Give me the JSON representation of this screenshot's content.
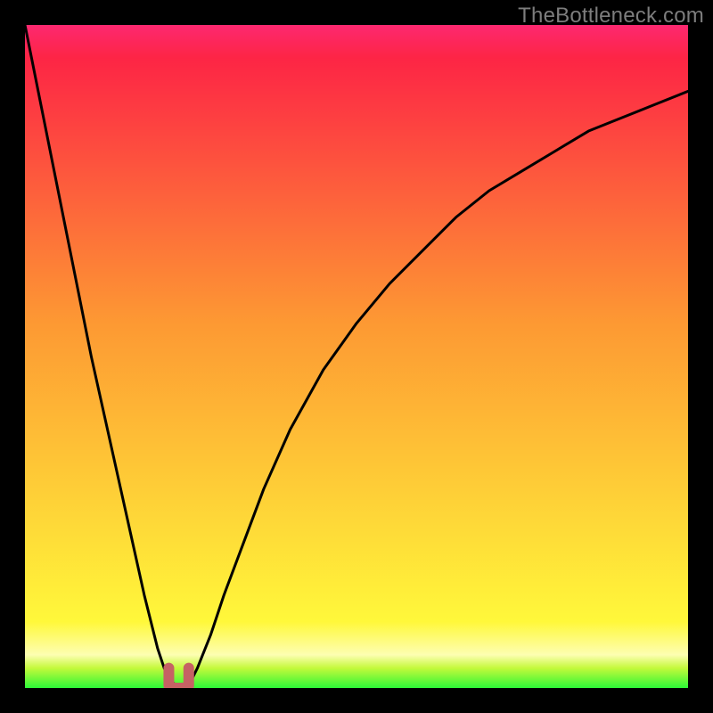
{
  "watermark": "TheBottleneck.com",
  "colors": {
    "black": "#000000",
    "curve": "#000000",
    "green": "#2cf837",
    "yellow": "#fff83a",
    "orange": "#fd9933",
    "red": "#fd2545",
    "pink": "#fd2870",
    "marker": "#c56264"
  },
  "chart_data": {
    "type": "line",
    "title": "",
    "xlabel": "",
    "ylabel": "",
    "xlim": [
      0,
      100
    ],
    "ylim": [
      0,
      100
    ],
    "grid": false,
    "legend": false,
    "gradient_stops": [
      {
        "offset": 0,
        "color": "#2cf837"
      },
      {
        "offset": 3,
        "color": "#c3f93b"
      },
      {
        "offset": 5,
        "color": "#fdfeb2"
      },
      {
        "offset": 10,
        "color": "#fff83a"
      },
      {
        "offset": 55,
        "color": "#fd9933"
      },
      {
        "offset": 95,
        "color": "#fd2545"
      },
      {
        "offset": 100,
        "color": "#fd2870"
      }
    ],
    "curve": {
      "x": [
        0,
        2,
        4,
        6,
        8,
        10,
        12,
        14,
        16,
        18,
        19,
        20,
        21,
        22,
        23,
        24,
        25,
        26,
        28,
        30,
        33,
        36,
        40,
        45,
        50,
        55,
        60,
        65,
        70,
        75,
        80,
        85,
        90,
        95,
        100
      ],
      "y": [
        100,
        90,
        80,
        70,
        60,
        50,
        41,
        32,
        23,
        14,
        10,
        6,
        3,
        1,
        0.3,
        0.3,
        1,
        3,
        8,
        14,
        22,
        30,
        39,
        48,
        55,
        61,
        66,
        71,
        75,
        78,
        81,
        84,
        86,
        88,
        90
      ]
    },
    "marker": {
      "x": 23.2,
      "y": 1.5,
      "width": 3.0,
      "height": 3.0,
      "shape": "u"
    }
  }
}
